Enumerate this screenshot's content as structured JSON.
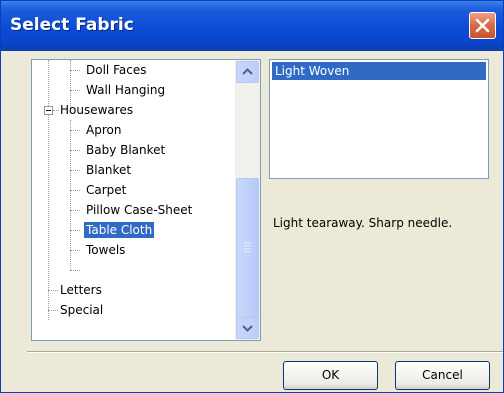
{
  "window": {
    "title": "Select Fabric"
  },
  "tree": {
    "items": [
      {
        "label": "Doll Faces"
      },
      {
        "label": "Wall Hanging"
      },
      {
        "label": "Housewares"
      },
      {
        "label": "Apron"
      },
      {
        "label": "Baby Blanket"
      },
      {
        "label": "Blanket"
      },
      {
        "label": "Carpet"
      },
      {
        "label": "Pillow Case-Sheet"
      },
      {
        "label": "Table Cloth"
      },
      {
        "label": "Towels"
      },
      {
        "label": "Letters"
      },
      {
        "label": "Special"
      }
    ],
    "selected": "Table Cloth"
  },
  "fabric_list": {
    "items": [
      "Light Woven"
    ],
    "selected": "Light Woven"
  },
  "description": "Light tearaway. Sharp needle.",
  "buttons": {
    "ok": "OK",
    "cancel": "Cancel"
  },
  "colors": {
    "title_bar": "#0b4bd6",
    "selection": "#316ac5",
    "close_button": "#d86a45",
    "dialog_bg": "#ece9d8"
  },
  "icons": {
    "close": "close-x-icon",
    "expander": "collapse-minus-icon",
    "scroll_up": "scroll-up-arrow-icon",
    "scroll_down": "scroll-down-arrow-icon"
  }
}
